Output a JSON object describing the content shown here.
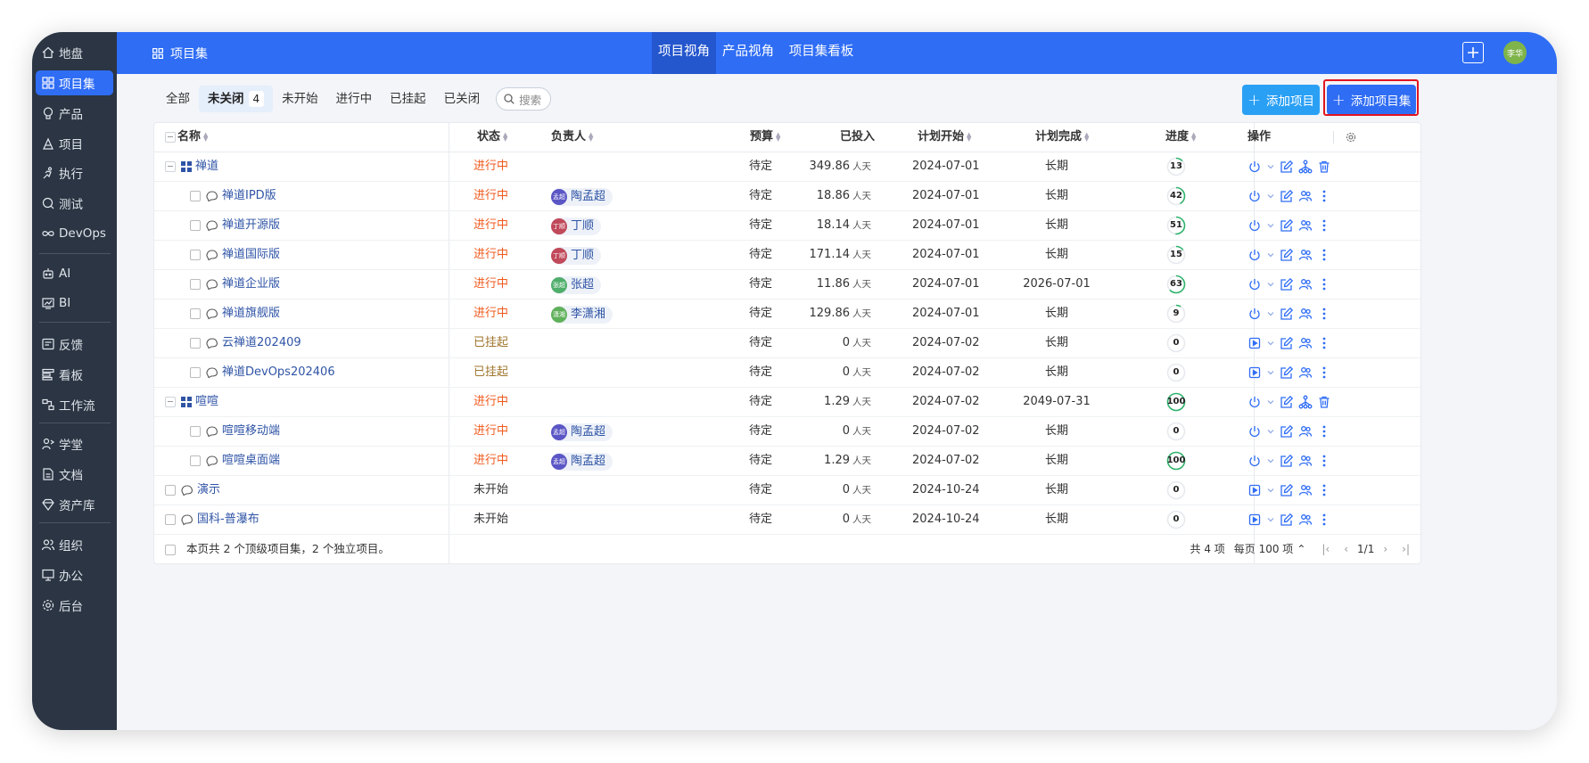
{
  "sidebar": {
    "items": [
      {
        "label": "地盘",
        "icon": "home-icon",
        "active": false
      },
      {
        "label": "项目集",
        "icon": "grid-icon",
        "active": true
      },
      {
        "label": "产品",
        "icon": "lightbulb-icon",
        "active": false
      },
      {
        "label": "项目",
        "icon": "project-icon",
        "active": false
      },
      {
        "label": "执行",
        "icon": "run-icon",
        "active": false
      },
      {
        "label": "测试",
        "icon": "test-icon",
        "active": false
      },
      {
        "label": "DevOps",
        "icon": "infinity-icon",
        "active": false
      },
      {
        "label": "AI",
        "icon": "robot-icon",
        "active": false
      },
      {
        "label": "BI",
        "icon": "chart-icon",
        "active": false
      },
      {
        "label": "反馈",
        "icon": "feedback-icon",
        "active": false
      },
      {
        "label": "看板",
        "icon": "kanban-icon",
        "active": false
      },
      {
        "label": "工作流",
        "icon": "workflow-icon",
        "active": false
      },
      {
        "label": "学堂",
        "icon": "school-icon",
        "active": false
      },
      {
        "label": "文档",
        "icon": "document-icon",
        "active": false
      },
      {
        "label": "资产库",
        "icon": "diamond-icon",
        "active": false
      },
      {
        "label": "组织",
        "icon": "people-icon",
        "active": false
      },
      {
        "label": "办公",
        "icon": "office-icon",
        "active": false
      },
      {
        "label": "后台",
        "icon": "settings-icon",
        "active": false
      }
    ]
  },
  "topbar": {
    "title": "项目集",
    "nav": [
      "项目视角",
      "产品视角",
      "项目集看板"
    ],
    "active_nav": "项目视角",
    "avatar": "李华"
  },
  "filters": {
    "tabs": [
      {
        "label": "全部"
      },
      {
        "label": "未关闭",
        "count": "4"
      },
      {
        "label": "未开始"
      },
      {
        "label": "进行中"
      },
      {
        "label": "已挂起"
      },
      {
        "label": "已关闭"
      }
    ],
    "search_label": "搜索"
  },
  "buttons": {
    "add_project": "添加项目",
    "add_set": "添加项目集"
  },
  "table": {
    "headers": {
      "name": "名称",
      "status": "状态",
      "owner": "负责人",
      "budget": "预算",
      "invested": "已投入",
      "plan_start": "计划开始",
      "plan_end": "计划完成",
      "progress": "进度",
      "actions": "操作"
    },
    "unit": "人天",
    "rows": [
      {
        "level": 0,
        "kind": "set",
        "name": "禅道",
        "status": "进行中",
        "owner": "",
        "owner_abbr": "",
        "budget": "待定",
        "invested": "349.86",
        "start": "2024-07-01",
        "end": "长期",
        "progress": 13,
        "actions": "set"
      },
      {
        "level": 1,
        "kind": "project",
        "name": "禅道IPD版",
        "status": "进行中",
        "owner": "陶孟超",
        "owner_abbr": "孟超",
        "budget": "待定",
        "invested": "18.86",
        "start": "2024-07-01",
        "end": "长期",
        "progress": 42,
        "actions": "project"
      },
      {
        "level": 1,
        "kind": "project",
        "name": "禅道开源版",
        "status": "进行中",
        "owner": "丁顺",
        "owner_abbr": "丁顺",
        "budget": "待定",
        "invested": "18.14",
        "start": "2024-07-01",
        "end": "长期",
        "progress": 51,
        "actions": "project"
      },
      {
        "level": 1,
        "kind": "project",
        "name": "禅道国际版",
        "status": "进行中",
        "owner": "丁顺",
        "owner_abbr": "丁顺",
        "budget": "待定",
        "invested": "171.14",
        "start": "2024-07-01",
        "end": "长期",
        "progress": 15,
        "actions": "project"
      },
      {
        "level": 1,
        "kind": "project",
        "name": "禅道企业版",
        "status": "进行中",
        "owner": "张超",
        "owner_abbr": "张超",
        "budget": "待定",
        "invested": "11.86",
        "start": "2024-07-01",
        "end": "2026-07-01",
        "progress": 63,
        "actions": "project"
      },
      {
        "level": 1,
        "kind": "project",
        "name": "禅道旗舰版",
        "status": "进行中",
        "owner": "李潇湘",
        "owner_abbr": "潇湘",
        "budget": "待定",
        "invested": "129.86",
        "start": "2024-07-01",
        "end": "长期",
        "progress": 9,
        "actions": "project"
      },
      {
        "level": 1,
        "kind": "project",
        "name": "云禅道202409",
        "status": "已挂起",
        "owner": "",
        "owner_abbr": "",
        "budget": "待定",
        "invested": "0",
        "start": "2024-07-02",
        "end": "长期",
        "progress": 0,
        "actions": "project-paused"
      },
      {
        "level": 1,
        "kind": "project",
        "name": "禅道DevOps202406",
        "status": "已挂起",
        "owner": "",
        "owner_abbr": "",
        "budget": "待定",
        "invested": "0",
        "start": "2024-07-02",
        "end": "长期",
        "progress": 0,
        "actions": "project-paused"
      },
      {
        "level": 0,
        "kind": "set",
        "name": "喧喧",
        "status": "进行中",
        "owner": "",
        "owner_abbr": "",
        "budget": "待定",
        "invested": "1.29",
        "start": "2024-07-02",
        "end": "2049-07-31",
        "progress": 100,
        "actions": "set"
      },
      {
        "level": 1,
        "kind": "project",
        "name": "喧喧移动端",
        "status": "进行中",
        "owner": "陶孟超",
        "owner_abbr": "孟超",
        "budget": "待定",
        "invested": "0",
        "start": "2024-07-02",
        "end": "长期",
        "progress": 0,
        "actions": "project"
      },
      {
        "level": 1,
        "kind": "project",
        "name": "喧喧桌面端",
        "status": "进行中",
        "owner": "陶孟超",
        "owner_abbr": "孟超",
        "budget": "待定",
        "invested": "1.29",
        "start": "2024-07-02",
        "end": "长期",
        "progress": 100,
        "actions": "project"
      },
      {
        "level": 0,
        "kind": "project",
        "name": "演示",
        "status": "未开始",
        "owner": "",
        "owner_abbr": "",
        "budget": "待定",
        "invested": "0",
        "start": "2024-10-24",
        "end": "长期",
        "progress": 0,
        "actions": "project-wait"
      },
      {
        "level": 0,
        "kind": "project",
        "name": "国科-普瀑布",
        "status": "未开始",
        "owner": "",
        "owner_abbr": "",
        "budget": "待定",
        "invested": "0",
        "start": "2024-10-24",
        "end": "长期",
        "progress": 0,
        "actions": "project-wait"
      }
    ],
    "footer": "本页共 2 个顶级项目集，2 个独立项目。",
    "pager": {
      "total": "共 4 项",
      "per_page": "每页 100 项",
      "page": "1/1"
    }
  },
  "colors": {
    "primary": "#2f6df5",
    "sidebar_bg": "#2b3543",
    "status_doing": "#f05a1d",
    "status_paused": "#a0752d",
    "highlight": "#e3141f",
    "progress_ring": "#2fb36b"
  }
}
